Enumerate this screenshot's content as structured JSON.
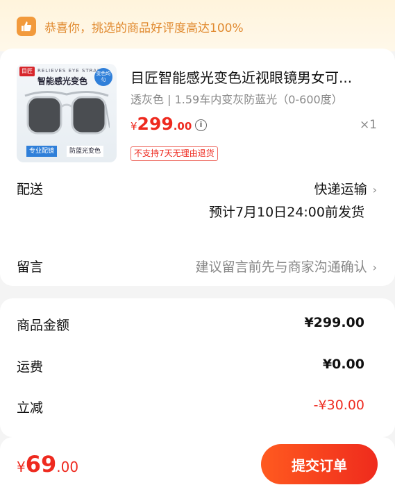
{
  "banner": {
    "text": "恭喜你，挑选的商品好评度高达100%",
    "icon": "thumbs-up-icon"
  },
  "product": {
    "image": {
      "logo": "目匠",
      "en": "RELIEVES EYE STRAIN",
      "cn": "智能感光变色",
      "bubble": "变色均匀",
      "tag1": "专业配镜",
      "tag2": "防蓝光变色"
    },
    "title": "目匠智能感光变色近视眼镜男女可...",
    "spec": "透灰色 | 1.59车内变灰防蓝光（0-600度）",
    "price": {
      "symbol": "¥",
      "integer": "299",
      "decimal": ".00"
    },
    "quantity": "×1",
    "no_return_tag": "不支持7天无理由退货"
  },
  "shipping": {
    "label": "配送",
    "method": "快递运输",
    "eta": "预计7月10日24:00前发货"
  },
  "note": {
    "label": "留言",
    "placeholder": "建议留言前先与商家沟通确认"
  },
  "summary": {
    "goods_label": "商品金额",
    "goods_value": "¥299.00",
    "freight_label": "运费",
    "freight_value": "¥0.00",
    "discount_label": "立减",
    "discount_value": "-¥30.00"
  },
  "footer": {
    "total": {
      "symbol": "¥",
      "integer": "69",
      "decimal": ".00"
    },
    "submit_label": "提交订单"
  },
  "colors": {
    "accent": "#ee2a1f",
    "banner_text": "#e0892e",
    "banner_bg": "#fff4dc"
  }
}
